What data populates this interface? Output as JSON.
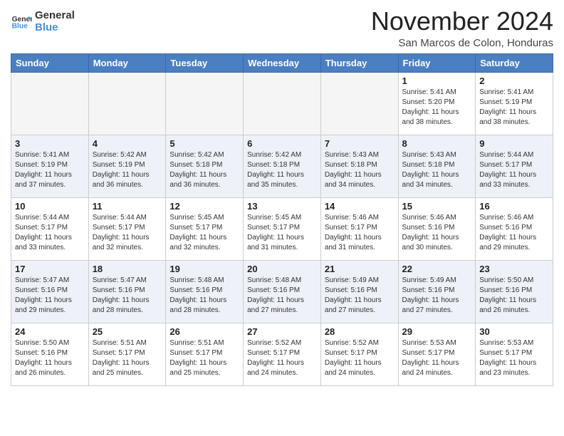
{
  "header": {
    "logo_line1": "General",
    "logo_line2": "Blue",
    "month_title": "November 2024",
    "subtitle": "San Marcos de Colon, Honduras"
  },
  "weekdays": [
    "Sunday",
    "Monday",
    "Tuesday",
    "Wednesday",
    "Thursday",
    "Friday",
    "Saturday"
  ],
  "weeks": [
    [
      {
        "day": "",
        "info": ""
      },
      {
        "day": "",
        "info": ""
      },
      {
        "day": "",
        "info": ""
      },
      {
        "day": "",
        "info": ""
      },
      {
        "day": "",
        "info": ""
      },
      {
        "day": "1",
        "info": "Sunrise: 5:41 AM\nSunset: 5:20 PM\nDaylight: 11 hours\nand 38 minutes."
      },
      {
        "day": "2",
        "info": "Sunrise: 5:41 AM\nSunset: 5:19 PM\nDaylight: 11 hours\nand 38 minutes."
      }
    ],
    [
      {
        "day": "3",
        "info": "Sunrise: 5:41 AM\nSunset: 5:19 PM\nDaylight: 11 hours\nand 37 minutes."
      },
      {
        "day": "4",
        "info": "Sunrise: 5:42 AM\nSunset: 5:19 PM\nDaylight: 11 hours\nand 36 minutes."
      },
      {
        "day": "5",
        "info": "Sunrise: 5:42 AM\nSunset: 5:18 PM\nDaylight: 11 hours\nand 36 minutes."
      },
      {
        "day": "6",
        "info": "Sunrise: 5:42 AM\nSunset: 5:18 PM\nDaylight: 11 hours\nand 35 minutes."
      },
      {
        "day": "7",
        "info": "Sunrise: 5:43 AM\nSunset: 5:18 PM\nDaylight: 11 hours\nand 34 minutes."
      },
      {
        "day": "8",
        "info": "Sunrise: 5:43 AM\nSunset: 5:18 PM\nDaylight: 11 hours\nand 34 minutes."
      },
      {
        "day": "9",
        "info": "Sunrise: 5:44 AM\nSunset: 5:17 PM\nDaylight: 11 hours\nand 33 minutes."
      }
    ],
    [
      {
        "day": "10",
        "info": "Sunrise: 5:44 AM\nSunset: 5:17 PM\nDaylight: 11 hours\nand 33 minutes."
      },
      {
        "day": "11",
        "info": "Sunrise: 5:44 AM\nSunset: 5:17 PM\nDaylight: 11 hours\nand 32 minutes."
      },
      {
        "day": "12",
        "info": "Sunrise: 5:45 AM\nSunset: 5:17 PM\nDaylight: 11 hours\nand 32 minutes."
      },
      {
        "day": "13",
        "info": "Sunrise: 5:45 AM\nSunset: 5:17 PM\nDaylight: 11 hours\nand 31 minutes."
      },
      {
        "day": "14",
        "info": "Sunrise: 5:46 AM\nSunset: 5:17 PM\nDaylight: 11 hours\nand 31 minutes."
      },
      {
        "day": "15",
        "info": "Sunrise: 5:46 AM\nSunset: 5:16 PM\nDaylight: 11 hours\nand 30 minutes."
      },
      {
        "day": "16",
        "info": "Sunrise: 5:46 AM\nSunset: 5:16 PM\nDaylight: 11 hours\nand 29 minutes."
      }
    ],
    [
      {
        "day": "17",
        "info": "Sunrise: 5:47 AM\nSunset: 5:16 PM\nDaylight: 11 hours\nand 29 minutes."
      },
      {
        "day": "18",
        "info": "Sunrise: 5:47 AM\nSunset: 5:16 PM\nDaylight: 11 hours\nand 28 minutes."
      },
      {
        "day": "19",
        "info": "Sunrise: 5:48 AM\nSunset: 5:16 PM\nDaylight: 11 hours\nand 28 minutes."
      },
      {
        "day": "20",
        "info": "Sunrise: 5:48 AM\nSunset: 5:16 PM\nDaylight: 11 hours\nand 27 minutes."
      },
      {
        "day": "21",
        "info": "Sunrise: 5:49 AM\nSunset: 5:16 PM\nDaylight: 11 hours\nand 27 minutes."
      },
      {
        "day": "22",
        "info": "Sunrise: 5:49 AM\nSunset: 5:16 PM\nDaylight: 11 hours\nand 27 minutes."
      },
      {
        "day": "23",
        "info": "Sunrise: 5:50 AM\nSunset: 5:16 PM\nDaylight: 11 hours\nand 26 minutes."
      }
    ],
    [
      {
        "day": "24",
        "info": "Sunrise: 5:50 AM\nSunset: 5:16 PM\nDaylight: 11 hours\nand 26 minutes."
      },
      {
        "day": "25",
        "info": "Sunrise: 5:51 AM\nSunset: 5:17 PM\nDaylight: 11 hours\nand 25 minutes."
      },
      {
        "day": "26",
        "info": "Sunrise: 5:51 AM\nSunset: 5:17 PM\nDaylight: 11 hours\nand 25 minutes."
      },
      {
        "day": "27",
        "info": "Sunrise: 5:52 AM\nSunset: 5:17 PM\nDaylight: 11 hours\nand 24 minutes."
      },
      {
        "day": "28",
        "info": "Sunrise: 5:52 AM\nSunset: 5:17 PM\nDaylight: 11 hours\nand 24 minutes."
      },
      {
        "day": "29",
        "info": "Sunrise: 5:53 AM\nSunset: 5:17 PM\nDaylight: 11 hours\nand 24 minutes."
      },
      {
        "day": "30",
        "info": "Sunrise: 5:53 AM\nSunset: 5:17 PM\nDaylight: 11 hours\nand 23 minutes."
      }
    ]
  ]
}
